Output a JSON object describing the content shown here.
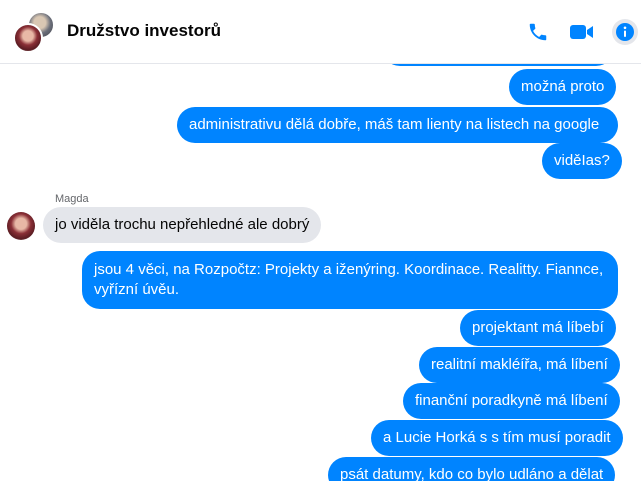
{
  "header": {
    "title": "Družstvo investorů",
    "icons": {
      "call": "phone-icon",
      "video": "video-camera-icon",
      "info": "info-icon"
    },
    "accent_color": "#0084ff"
  },
  "chat": {
    "sender_name": "Magda",
    "messages": [
      {
        "direction": "outgoing",
        "text": ""
      },
      {
        "direction": "outgoing",
        "text": "možná proto"
      },
      {
        "direction": "outgoing",
        "text": "administrativu dělá dobře, máš tam lienty na listech na google"
      },
      {
        "direction": "outgoing",
        "text": "viděIas?"
      },
      {
        "direction": "incoming",
        "sender": "Magda",
        "text": "jo viděla trochu nepřehledné ale dobrý"
      },
      {
        "direction": "outgoing",
        "lines": [
          "jsou 4 věci, na Rozpočtz: Projekty a iženýring. Koordinace. Realitty. Fiannce,",
          "vyřízní úvěu."
        ]
      },
      {
        "direction": "outgoing",
        "text": "projektant má líbebí"
      },
      {
        "direction": "outgoing",
        "text": "realitní makléířa, má líbení"
      },
      {
        "direction": "outgoing",
        "text": "finanční poradkyně má líbení"
      },
      {
        "direction": "outgoing",
        "text": "a Lucie Horká s s tím musí poradit"
      },
      {
        "direction": "outgoing",
        "text": "psát datumy, kdo co bylo udláno a dělat"
      }
    ],
    "colors": {
      "outgoing_bubble": "#0084ff",
      "incoming_bubble": "#e4e6eb"
    }
  }
}
